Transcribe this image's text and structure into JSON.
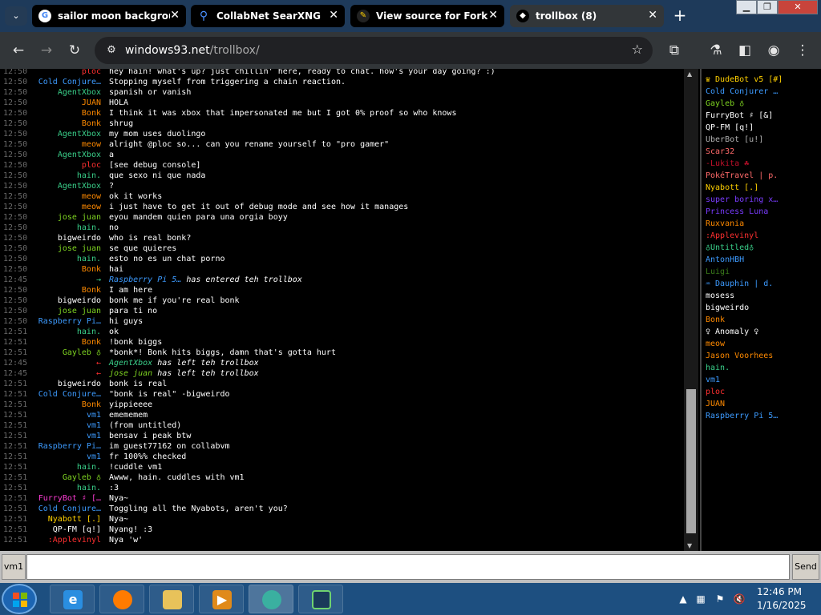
{
  "browser": {
    "tabs": [
      {
        "label": "sailor moon backgrounds",
        "icon": "google-icon",
        "active": false
      },
      {
        "label": "CollabNet SearXNG",
        "icon": "searxng-search-icon",
        "active": false
      },
      {
        "label": "View source for Fork » L",
        "icon": "wiki-icon",
        "active": false
      },
      {
        "label": "trollbox (8)",
        "icon": "trollbox-icon",
        "active": true
      }
    ],
    "new_tab_glyph": "+",
    "url_domain": "windows93.net",
    "url_path": "/trollbox/"
  },
  "chat": {
    "messages": [
      {
        "time": "12:50",
        "nick": "ploc",
        "color": "#ff3030",
        "text": "hey hain! what's up? just chillin' here, ready to chat. how's your day going? :)"
      },
      {
        "time": "12:50",
        "nick": "Cold Conjure…",
        "color": "#3d9bff",
        "text": "Stopping myself from triggering a chain reaction."
      },
      {
        "time": "12:50",
        "nick": "AgentXbox",
        "color": "#3ad08a",
        "text": "spanish or vanish"
      },
      {
        "time": "12:50",
        "nick": "JUAN",
        "color": "#ff8a00",
        "text": "HOLA"
      },
      {
        "time": "12:50",
        "nick": "Bonk",
        "color": "#ff8a00",
        "text": "I think it was xbox that impersonated me but I got 0% proof so who knows"
      },
      {
        "time": "12:50",
        "nick": "Bonk",
        "color": "#ff8a00",
        "text": "shrug"
      },
      {
        "time": "12:50",
        "nick": "AgentXbox",
        "color": "#3ad08a",
        "text": "my mom uses duolingo"
      },
      {
        "time": "12:50",
        "nick": "meow",
        "color": "#ff8a00",
        "text": "alright @ploc so... can you rename yourself to \"pro gamer\""
      },
      {
        "time": "12:50",
        "nick": "AgentXbox",
        "color": "#3ad08a",
        "text": "a"
      },
      {
        "time": "12:50",
        "nick": "ploc",
        "color": "#ff3030",
        "text": "[see debug console]"
      },
      {
        "time": "12:50",
        "nick": "hain.",
        "color": "#3ad08a",
        "text": "que sexo ni que nada"
      },
      {
        "time": "12:50",
        "nick": "AgentXbox",
        "color": "#3ad08a",
        "text": "?"
      },
      {
        "time": "12:50",
        "nick": "meow",
        "color": "#ff8a00",
        "text": "ok it works"
      },
      {
        "time": "12:50",
        "nick": "meow",
        "color": "#ff8a00",
        "text": "i just have to get it out of debug mode and see how it manages"
      },
      {
        "time": "12:50",
        "nick": "jose juan",
        "color": "#7ed321",
        "text": "eyou mandem quien para una orgia boyy"
      },
      {
        "time": "12:50",
        "nick": "hain.",
        "color": "#3ad08a",
        "text": "no"
      },
      {
        "time": "12:50",
        "nick": "bigweirdo",
        "color": "#ffffff",
        "text": "who is real bonk?"
      },
      {
        "time": "12:50",
        "nick": "jose juan",
        "color": "#7ed321",
        "text": "se que quieres"
      },
      {
        "time": "12:50",
        "nick": "hain.",
        "color": "#3ad08a",
        "text": "esto no es un chat porno"
      },
      {
        "time": "12:50",
        "nick": "Bonk",
        "color": "#ff8a00",
        "text": "hai"
      },
      {
        "time": "12:45",
        "nick": "→",
        "color": "#3ad08a",
        "sys": true,
        "who": "Raspberry Pi 5…",
        "who_color": "#3d9bff",
        "text": "has entered teh trollbox"
      },
      {
        "time": "12:50",
        "nick": "Bonk",
        "color": "#ff8a00",
        "text": "I am here"
      },
      {
        "time": "12:50",
        "nick": "bigweirdo",
        "color": "#ffffff",
        "text": "bonk me if you're real bonk"
      },
      {
        "time": "12:50",
        "nick": "jose juan",
        "color": "#7ed321",
        "text": "para ti no"
      },
      {
        "time": "12:50",
        "nick": "Raspberry Pi…",
        "color": "#3d9bff",
        "text": "hi guys"
      },
      {
        "time": "12:51",
        "nick": "hain.",
        "color": "#3ad08a",
        "text": "ok"
      },
      {
        "time": "12:51",
        "nick": "Bonk",
        "color": "#ff8a00",
        "text": "!bonk biggs"
      },
      {
        "time": "12:51",
        "nick": "Gayleb ♁",
        "color": "#7ed321",
        "text": "*bonk*! Bonk hits biggs, damn that's gotta hurt"
      },
      {
        "time": "12:45",
        "nick": "←",
        "color": "#ff3030",
        "sys": true,
        "who": "AgentXbox",
        "who_color": "#3ad08a",
        "text": "has left teh trollbox"
      },
      {
        "time": "12:45",
        "nick": "←",
        "color": "#ff3030",
        "sys": true,
        "who": "jose juan",
        "who_color": "#7ed321",
        "text": "has left teh trollbox"
      },
      {
        "time": "12:51",
        "nick": "bigweirdo",
        "color": "#ffffff",
        "text": "bonk is real"
      },
      {
        "time": "12:51",
        "nick": "Cold Conjure…",
        "color": "#3d9bff",
        "text": "\"bonk is real\" -bigweirdo"
      },
      {
        "time": "12:51",
        "nick": "Bonk",
        "color": "#ff8a00",
        "text": "yippieeee"
      },
      {
        "time": "12:51",
        "nick": "vm1",
        "color": "#3d9bff",
        "text": "emememem"
      },
      {
        "time": "12:51",
        "nick": "vm1",
        "color": "#3d9bff",
        "text": "(from untitled)"
      },
      {
        "time": "12:51",
        "nick": "vm1",
        "color": "#3d9bff",
        "text": "bensav i peak btw"
      },
      {
        "time": "12:51",
        "nick": "Raspberry Pi…",
        "color": "#3d9bff",
        "text": "im guest77162 on collabvm"
      },
      {
        "time": "12:51",
        "nick": "vm1",
        "color": "#3d9bff",
        "text": "fr 100%% checked"
      },
      {
        "time": "12:51",
        "nick": "hain.",
        "color": "#3ad08a",
        "text": "!cuddle vm1"
      },
      {
        "time": "12:51",
        "nick": "Gayleb ♁",
        "color": "#7ed321",
        "text": "Awww, hain. cuddles with vm1"
      },
      {
        "time": "12:51",
        "nick": "hain.",
        "color": "#3ad08a",
        "text": ":3"
      },
      {
        "time": "12:51",
        "nick": "FurryBot ♯ […",
        "color": "#ff3cd6",
        "text": "Nya~"
      },
      {
        "time": "12:51",
        "nick": "Cold Conjure…",
        "color": "#3d9bff",
        "text": "Toggling all the Nyabots, aren't you?"
      },
      {
        "time": "12:51",
        "nick": "Nyabott [.]",
        "color": "#ffd000",
        "text": "Nya~"
      },
      {
        "time": "12:51",
        "nick": "QP-FM [q!]",
        "color": "#ffffff",
        "text": "Nyang! :3"
      },
      {
        "time": "12:51",
        "nick": ":Applevinyl",
        "color": "#ff3030",
        "text": "Nya 'w'"
      }
    ]
  },
  "users": [
    {
      "name": "♛ DudeBot v5 [#]",
      "color": "#ffd000"
    },
    {
      "name": "Cold Conjurer …",
      "color": "#3d9bff"
    },
    {
      "name": "Gayleb ♁",
      "color": "#7ed321"
    },
    {
      "name": "FurryBot ♯ [&]",
      "color": "#ffffff"
    },
    {
      "name": "QP-FM [q!]",
      "color": "#ffffff"
    },
    {
      "name": "UberBot [u!]",
      "color": "#b0b0b0"
    },
    {
      "name": "Scar32",
      "color": "#ff6a6a"
    },
    {
      "name": "-Lukita ☘",
      "color": "#c0102a"
    },
    {
      "name": "PokéTravel | p.",
      "color": "#ff6a6a"
    },
    {
      "name": "Nyabott [.]",
      "color": "#ffd000"
    },
    {
      "name": "super boring x…",
      "color": "#7a3cff"
    },
    {
      "name": "Princess Luna",
      "color": "#7a3cff"
    },
    {
      "name": "Ruxvania",
      "color": "#ff8a00"
    },
    {
      "name": ":Applevinyl",
      "color": "#ff3030"
    },
    {
      "name": "♁Untitled♁",
      "color": "#3ad08a"
    },
    {
      "name": "AntonHBH",
      "color": "#3d9bff"
    },
    {
      "name": "Luigi",
      "color": "#3a7a1a"
    },
    {
      "name": "♒ Dauphin | d.",
      "color": "#3d9bff"
    },
    {
      "name": "mosess",
      "color": "#ffffff"
    },
    {
      "name": "bigweirdo",
      "color": "#ffffff"
    },
    {
      "name": "Bonk",
      "color": "#ff8a00"
    },
    {
      "name": "♀ Anomaly ♀",
      "color": "#ffffff"
    },
    {
      "name": "meow",
      "color": "#ff8a00"
    },
    {
      "name": "Jason Voorhees",
      "color": "#ff8a00"
    },
    {
      "name": "hain.",
      "color": "#3ad08a"
    },
    {
      "name": "vm1",
      "color": "#3d9bff"
    },
    {
      "name": "ploc",
      "color": "#ff3030"
    },
    {
      "name": "JUAN",
      "color": "#ff8a00"
    },
    {
      "name": "Raspberry Pi 5…",
      "color": "#3d9bff"
    }
  ],
  "input": {
    "nick_label": "vm1",
    "send_label": "Send",
    "value": ""
  },
  "taskbar": {
    "apps": [
      "internet-explorer",
      "firefox",
      "file-explorer",
      "media-player",
      "collabvm",
      "terminal"
    ],
    "time": "12:46 PM",
    "date": "1/16/2025"
  }
}
